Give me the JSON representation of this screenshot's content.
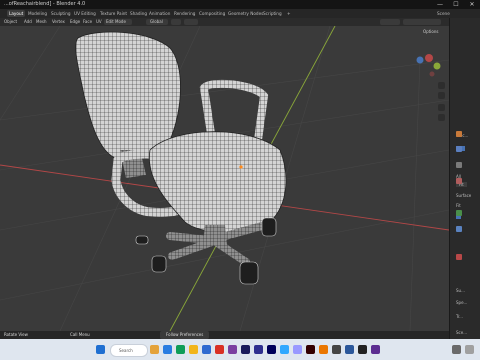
{
  "window": {
    "title": "...ofReachairblend] - Blender 4.0",
    "minimize": "—",
    "maximize": "☐",
    "close": "✕"
  },
  "menu": {
    "tabs": [
      "Layout",
      "Modeling",
      "Sculpting",
      "UV Editing",
      "Texture Paint",
      "Shading",
      "Animation",
      "Rendering",
      "Compositing",
      "Geometry Nodes",
      "Scripting",
      "+"
    ],
    "active": 0,
    "scene_label": "Scene"
  },
  "header": {
    "items": [
      "Object",
      "Add",
      "Mesh",
      "Vertex",
      "Edge",
      "Face",
      "UV"
    ],
    "mode": "Edit Mode",
    "pivot": "Global"
  },
  "overlay": {
    "options_label": "Options"
  },
  "sidepanel": {
    "rows": [
      "Proc...",
      "All",
      "Fit",
      "Surface",
      "Fit",
      "Su...",
      "Spe...",
      "Tr...",
      "Sce..."
    ]
  },
  "statusbar": {
    "left": "Rotate View",
    "mid": "Call Menu",
    "center": "Follow Preferences"
  },
  "taskbar": {
    "search_placeholder": "Search",
    "time": ""
  },
  "colors": {
    "accent": "#4772b3",
    "viewport_bg": "#3a3a3a",
    "grid_red": "#b34747",
    "grid_green": "#8aa839",
    "taskbar_bg": "#dfe6ef"
  }
}
